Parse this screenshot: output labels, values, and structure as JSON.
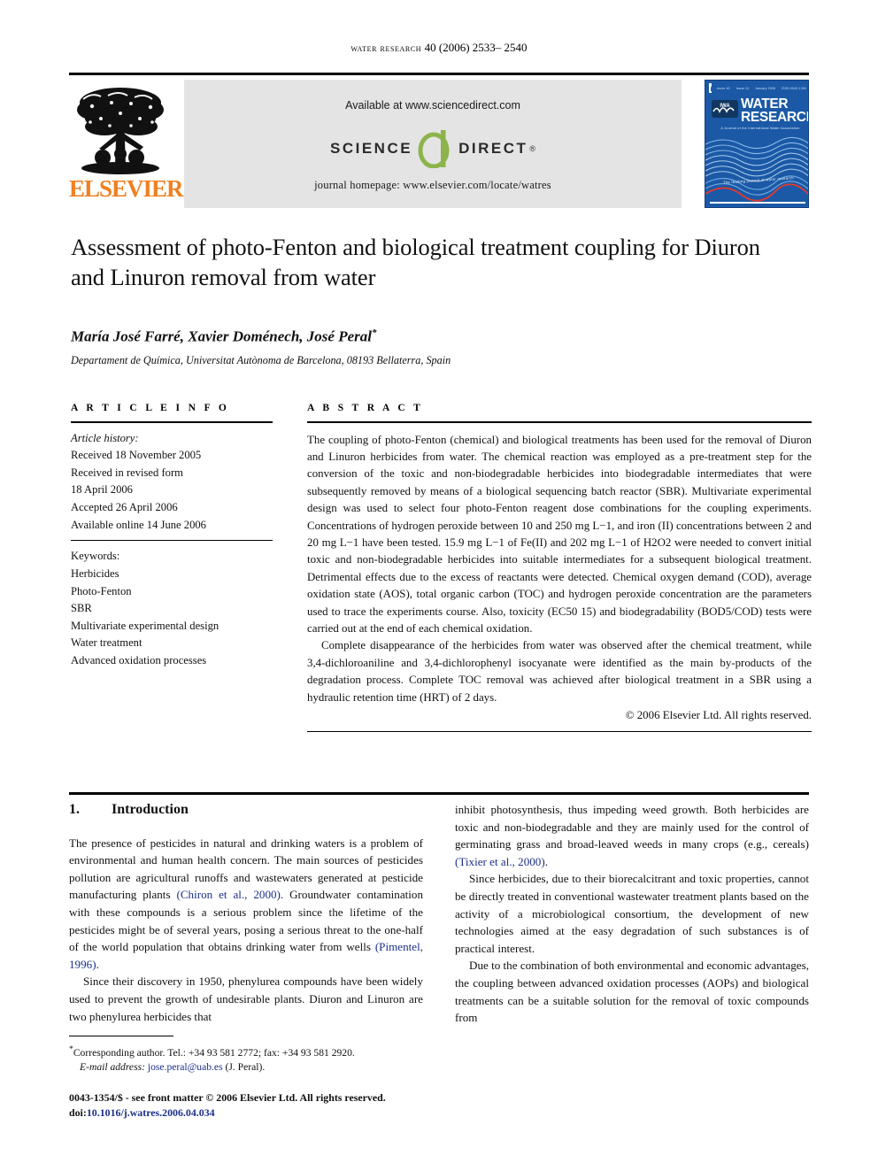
{
  "running_head": {
    "journal": "water research",
    "volume_pages": "40 (2006) 2533– 2540"
  },
  "masthead": {
    "publisher_name": "ELSEVIER",
    "available_at": "Available at www.sciencedirect.com",
    "logo_science": "SCIENCE",
    "logo_direct": "DIRECT",
    "logo_reg": "®",
    "journal_homepage": "journal homepage: www.elsevier.com/locate/watres",
    "cover": {
      "title_line1": "WATER",
      "title_line2": "RESEARCH",
      "iwa_label": "IWA",
      "subtitle": "A Journal of the International Water Association",
      "wave_text": "The leading journal of water research",
      "meta": [
        "Volume 40",
        "Issue 13",
        "January 2006",
        "ISSN 0043-1354"
      ]
    }
  },
  "article": {
    "title": "Assessment of photo-Fenton and biological treatment coupling for Diuron and Linuron removal from water",
    "authors": "María José Farré, Xavier Doménech, José Peral",
    "corresponding_marker": "*",
    "affiliation": "Departament de Química, Universitat Autònoma de Barcelona, 08193 Bellaterra, Spain"
  },
  "article_info": {
    "heading": "A R T I C L E   I N F O",
    "history_label": "Article history:",
    "history": [
      "Received 18 November 2005",
      "Received in revised form",
      "18 April 2006",
      "Accepted 26 April 2006",
      "Available online 14 June 2006"
    ],
    "keywords_label": "Keywords:",
    "keywords": [
      "Herbicides",
      "Photo-Fenton",
      "SBR",
      "Multivariate experimental design",
      "Water treatment",
      "Advanced oxidation processes"
    ]
  },
  "abstract": {
    "heading": "A B S T R A C T",
    "paragraph1": "The coupling of photo-Fenton (chemical) and biological treatments has been used for the removal of Diuron and Linuron herbicides from water. The chemical reaction was employed as a pre-treatment step for the conversion of the toxic and non-biodegradable herbicides into biodegradable intermediates that were subsequently removed by means of a biological sequencing batch reactor (SBR). Multivariate experimental design was used to select four photo-Fenton reagent dose combinations for the coupling experiments. Concentrations of hydrogen peroxide between 10 and 250 mg L−1, and iron (II) concentrations between 2 and 20 mg L−1 have been tested. 15.9 mg L−1 of Fe(II) and 202 mg L−1 of H2O2 were needed to convert initial toxic and non-biodegradable herbicides into suitable intermediates for a subsequent biological treatment. Detrimental effects due to the excess of reactants were detected. Chemical oxygen demand (COD), average oxidation state (AOS), total organic carbon (TOC) and hydrogen peroxide concentration are the parameters used to trace the experiments course. Also, toxicity (EC50 15) and biodegradability (BOD5/COD) tests were carried out at the end of each chemical oxidation.",
    "paragraph2": "Complete disappearance of the herbicides from water was observed after the chemical treatment, while 3,4-dichloroaniline and 3,4-dichlorophenyl isocyanate were identified as the main by-products of the degradation process. Complete TOC removal was achieved after biological treatment in a SBR using a hydraulic retention time (HRT) of 2 days.",
    "copyright": "© 2006 Elsevier Ltd. All rights reserved."
  },
  "introduction": {
    "number": "1.",
    "heading": "Introduction",
    "left_p1_a": "The presence of pesticides in natural and drinking waters is a problem of environmental and human health concern. The main sources of pesticides pollution are agricultural runoffs and wastewaters generated at pesticide manufacturing plants ",
    "left_cite1": "(Chiron et al., 2000)",
    "left_p1_b": ". Groundwater contamination with these compounds is a serious problem since the lifetime of the pesticides might be of several years, posing a serious threat to the one-half of the world population that obtains drinking water from wells ",
    "left_cite2": "(Pimentel, 1996)",
    "left_p1_c": ".",
    "left_p2": "Since their discovery in 1950, phenylurea compounds have been widely used to prevent the growth of undesirable plants. Diuron and Linuron are two phenylurea herbicides that",
    "right_p1_a": "inhibit photosynthesis, thus impeding weed growth. Both herbicides are toxic and non-biodegradable and they are mainly used for the control of germinating grass and broad-leaved weeds in many crops (e.g., cereals) ",
    "right_cite1": "(Tixier et al., 2000)",
    "right_p1_b": ".",
    "right_p2": "Since herbicides, due to their biorecalcitrant and toxic properties, cannot be directly treated in conventional wastewater treatment plants based on the activity of a microbiological consortium, the development of new technologies aimed at the easy degradation of such substances is of practical interest.",
    "right_p3": "Due to the combination of both environmental and economic advantages, the coupling between advanced oxidation processes (AOPs) and biological treatments can be a suitable solution for the removal of toxic compounds from"
  },
  "footnotes": {
    "corresponding": "Corresponding author. Tel.: +34 93 581 2772; fax: +34 93 581 2920.",
    "email_label": "E-mail address:",
    "email": "jose.peral@uab.es",
    "email_owner": "(J. Peral).",
    "issn_line": "0043-1354/$ - see front matter © 2006 Elsevier Ltd. All rights reserved.",
    "doi_label": "doi:",
    "doi": "10.1016/j.watres.2006.04.034"
  },
  "colors": {
    "elsevier_orange": "#F08020",
    "sciencedirect_green": "#8CB44A",
    "banner_gray": "#E4E4E4",
    "cover_blue": "#1B59A6",
    "link_navy": "#1b2f8a"
  }
}
